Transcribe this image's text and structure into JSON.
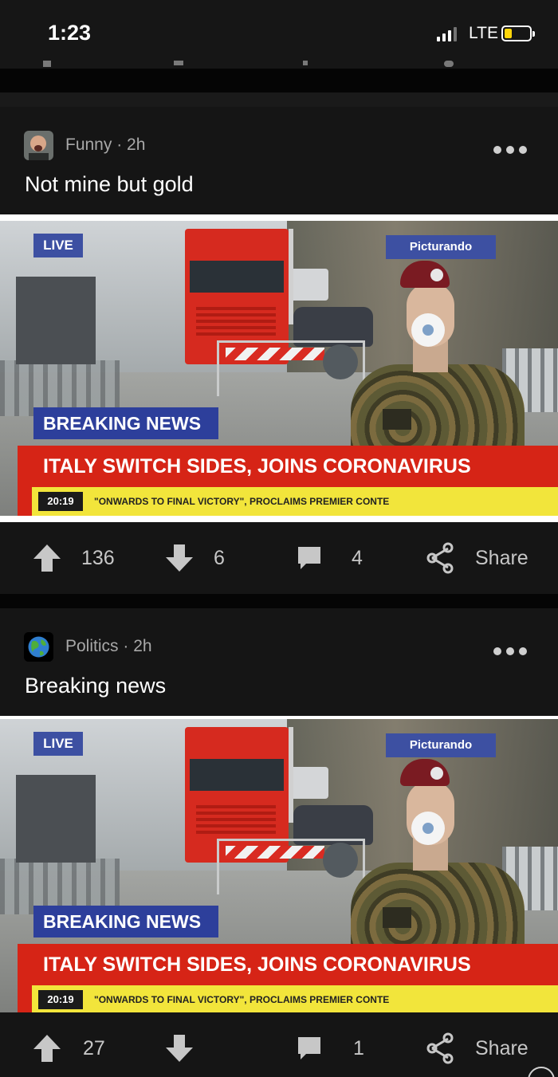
{
  "status_bar": {
    "time": "1:23",
    "network": "LTE"
  },
  "posts": [
    {
      "section": "Funny",
      "age": "· 2h",
      "title": "Not mine but gold",
      "meme": {
        "live": "LIVE",
        "brand": "Picturando",
        "breaking": "BREAKING NEWS",
        "headline": "ITALY SWITCH SIDES, JOINS CORONAVIRUS",
        "clock": "20:19",
        "ticker": "\"ONWARDS TO FINAL VICTORY\", PROCLAIMS PREMIER CONTE"
      },
      "upvotes": "136",
      "downvotes": "6",
      "comments": "4",
      "share_label": "Share"
    },
    {
      "section": "Politics",
      "age": "· 2h",
      "title": "Breaking news",
      "meme": {
        "live": "LIVE",
        "brand": "Picturando",
        "breaking": "BREAKING NEWS",
        "headline": "ITALY SWITCH SIDES, JOINS CORONAVIRUS",
        "clock": "20:19",
        "ticker": "\"ONWARDS TO FINAL VICTORY\", PROCLAIMS PREMIER CONTE"
      },
      "upvotes": "27",
      "downvotes": "",
      "comments": "1",
      "share_label": "Share"
    }
  ],
  "colors": {
    "accent_blue": "#3d50a2",
    "headline_red": "#d62416",
    "ticker_yellow": "#f2e53b",
    "battery": "#ffd60a"
  },
  "icons": [
    "signal-icon",
    "battery-icon",
    "more-icon",
    "upvote-icon",
    "downvote-icon",
    "comment-icon",
    "share-icon",
    "avatar-icon",
    "globe-icon"
  ]
}
